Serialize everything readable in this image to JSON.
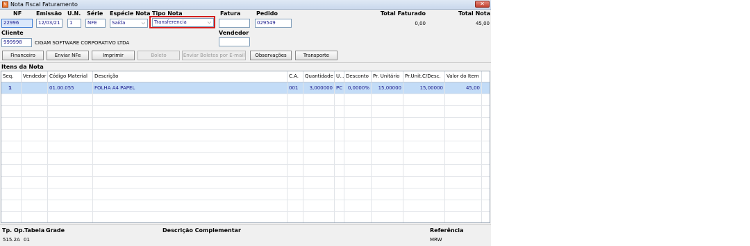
{
  "window": {
    "title": "Nota Fiscal Faturamento",
    "close_glyph": "✕",
    "icon_glyph": "N"
  },
  "header": {
    "nf_label": "NF",
    "nf_value": "22996",
    "emissao_label": "Emissão",
    "emissao_value": "12/03/21",
    "un_label": "U.N.",
    "un_value": "1",
    "serie_label": "Série",
    "serie_value": "NFE",
    "especie_label": "Espécie Nota",
    "especie_value": "Saída",
    "tipo_label": "Tipo Nota",
    "tipo_value": "Transferencia",
    "fatura_label": "Fatura",
    "fatura_value": "",
    "pedido_label": "Pedido",
    "pedido_value": "029549",
    "total_faturado_label": "Total Faturado",
    "total_faturado_value": "0,00",
    "total_nota_label": "Total Nota",
    "total_nota_value": "45,00",
    "cliente_label": "Cliente",
    "cliente_code": "999998",
    "cliente_name": "CIGAM SOFTWARE CORPORATIVO LTDA",
    "vendedor_label": "Vendedor",
    "vendedor_value": ""
  },
  "toolbar": {
    "financeiro": "Financeiro",
    "enviar_nfe": "Enviar NFe",
    "imprimir": "Imprimir",
    "boleto": "Boleto",
    "enviar_boletos": "Enviar Boletos por E-mail",
    "observacoes": "Observações",
    "transporte": "Transporte"
  },
  "items": {
    "section_title": "Itens da Nota",
    "columns": [
      "Seq.",
      "Vendedor",
      "Código Material",
      "Descrição",
      "C.A.",
      "Quantidade",
      "U...",
      "Desconto",
      "Pr. Unitário",
      "Pr.Unit.C/Desc.",
      "Valor do Item"
    ],
    "rows": [
      [
        "1",
        "",
        "01.00.055",
        "FOLHA A4 PAPEL",
        "001",
        "3,000000",
        "PC",
        "0,0000%",
        "15,00000",
        "15,00000",
        "45,00"
      ]
    ]
  },
  "footer": {
    "tp_op_label": "Tp. Op.",
    "tp_op_value": "515.2A",
    "tabela_label": "Tabela",
    "tabela_value": "01",
    "grade_label": "Grade",
    "desc_compl_label": "Descrição Complementar",
    "referencia_label": "Referência",
    "referencia_value": "MRW"
  },
  "colors": {
    "selected_row": "#c3dcf7",
    "highlight_border": "#d21e1e",
    "value_text": "#1a1a8c"
  }
}
